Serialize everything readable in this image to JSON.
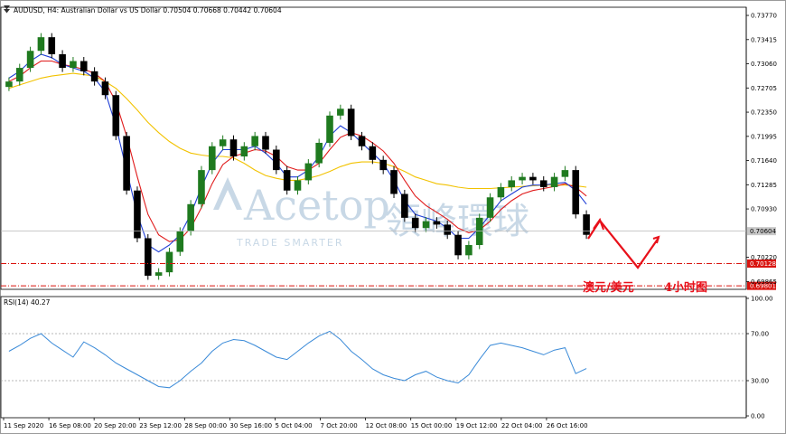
{
  "window": {
    "symbol_caption": "AUDUSD, H4:  Australian Dollar vs US Dollar  0.70504 0.70668 0.70442 0.70604"
  },
  "rsi": {
    "caption": "RSI(14) 40.27",
    "levels": [
      "100.00",
      "70.00",
      "30.00",
      "0.00"
    ]
  },
  "watermark": {
    "brand": "Acetop",
    "cn": "領峰環球",
    "tagline": "TRADE SMARTER"
  },
  "annotation": {
    "pair_cn": "澳元/美元",
    "timeframe_cn": "4小时图"
  },
  "colors": {
    "bull": "#1f7a1f",
    "bear": "#000000",
    "ma_blue": "#1f3fd6",
    "ma_red": "#e01b1b",
    "ma_yellow": "#f2c200",
    "rsi": "#3a8ad8",
    "level_red": "#d9140f",
    "arrow": "#e8101a"
  },
  "chart_data": [
    {
      "type": "candlestick",
      "title": "AUDUSD, H4:  Australian Dollar vs US Dollar",
      "ohlc_last": {
        "open": 0.70504,
        "high": 0.70668,
        "low": 0.70442,
        "close": 0.70604
      },
      "y_ticks": [
        "0.73770",
        "0.73415",
        "0.73060",
        "0.72705",
        "0.72350",
        "0.71995",
        "0.71640",
        "0.71285",
        "0.70930",
        "0.70220",
        "0.69865"
      ],
      "ylim": [
        0.6975,
        0.7389
      ],
      "x_ticks": [
        "11 Sep 2020",
        "16 Sep 08:00",
        "20 Sep 20:00",
        "23 Sep 12:00",
        "28 Sep 00:00",
        "30 Sep 16:00",
        "5 Oct 04:00",
        "7 Oct 20:00",
        "12 Oct 08:00",
        "15 Oct 00:00",
        "19 Oct 12:00",
        "22 Oct 04:00",
        "26 Oct 16:00"
      ],
      "current_price": "0.70604",
      "levels": [
        {
          "label": "0.70128",
          "value": 0.70128
        },
        {
          "label": "0.69801",
          "value": 0.69801
        }
      ],
      "series": [
        {
          "name": "close",
          "values": [
            0.728,
            0.73,
            0.7325,
            0.7345,
            0.732,
            0.73,
            0.731,
            0.7295,
            0.728,
            0.726,
            0.72,
            0.712,
            0.705,
            0.6995,
            0.7,
            0.703,
            0.706,
            0.71,
            0.715,
            0.7185,
            0.7195,
            0.717,
            0.7185,
            0.72,
            0.718,
            0.715,
            0.712,
            0.7135,
            0.716,
            0.719,
            0.723,
            0.724,
            0.72,
            0.7185,
            0.7165,
            0.715,
            0.7115,
            0.708,
            0.7065,
            0.7075,
            0.707,
            0.7055,
            0.7025,
            0.704,
            0.708,
            0.711,
            0.7125,
            0.7135,
            0.714,
            0.7135,
            0.7125,
            0.714,
            0.715,
            0.7085,
            0.7055
          ]
        },
        {
          "name": "ma_blue",
          "values": [
            0.7285,
            0.7295,
            0.731,
            0.732,
            0.7315,
            0.7305,
            0.73,
            0.7295,
            0.7285,
            0.7265,
            0.7215,
            0.715,
            0.7085,
            0.704,
            0.703,
            0.704,
            0.7055,
            0.7085,
            0.7125,
            0.716,
            0.718,
            0.718,
            0.718,
            0.7185,
            0.7175,
            0.716,
            0.714,
            0.714,
            0.715,
            0.717,
            0.72,
            0.7215,
            0.7205,
            0.719,
            0.7175,
            0.716,
            0.7135,
            0.7105,
            0.7085,
            0.708,
            0.7075,
            0.7065,
            0.705,
            0.705,
            0.7065,
            0.7085,
            0.7105,
            0.7115,
            0.7125,
            0.7128,
            0.7128,
            0.713,
            0.7132,
            0.712,
            0.71
          ]
        },
        {
          "name": "ma_red",
          "values": [
            0.728,
            0.7288,
            0.73,
            0.731,
            0.731,
            0.7305,
            0.7302,
            0.7298,
            0.7292,
            0.728,
            0.725,
            0.72,
            0.714,
            0.7085,
            0.7055,
            0.7045,
            0.7048,
            0.7065,
            0.7095,
            0.713,
            0.7158,
            0.717,
            0.7175,
            0.718,
            0.7178,
            0.717,
            0.7155,
            0.715,
            0.715,
            0.716,
            0.718,
            0.7198,
            0.7205,
            0.72,
            0.719,
            0.7178,
            0.716,
            0.7135,
            0.7112,
            0.7098,
            0.7088,
            0.7078,
            0.7065,
            0.7058,
            0.7062,
            0.7075,
            0.7092,
            0.7105,
            0.7115,
            0.712,
            0.7123,
            0.7126,
            0.713,
            0.7125,
            0.7112
          ]
        },
        {
          "name": "ma_yellow",
          "values": [
            0.727,
            0.7275,
            0.728,
            0.7285,
            0.7288,
            0.729,
            0.7292,
            0.729,
            0.7288,
            0.728,
            0.727,
            0.7255,
            0.7238,
            0.722,
            0.7205,
            0.7192,
            0.7182,
            0.7175,
            0.7172,
            0.717,
            0.717,
            0.7168,
            0.716,
            0.715,
            0.7142,
            0.7138,
            0.7135,
            0.7135,
            0.7138,
            0.7142,
            0.7148,
            0.7155,
            0.716,
            0.7162,
            0.7162,
            0.716,
            0.7155,
            0.7148,
            0.714,
            0.7135,
            0.713,
            0.7128,
            0.7125,
            0.7123,
            0.7123,
            0.7123,
            0.7124,
            0.7125,
            0.7126,
            0.7127,
            0.7128,
            0.7128,
            0.7128,
            0.7127,
            0.7125
          ]
        }
      ]
    },
    {
      "type": "line",
      "title": "RSI(14) 40.27",
      "ylim": [
        0,
        100
      ],
      "y_ticks": [
        "100.00",
        "70.00",
        "30.00",
        "0.00"
      ],
      "series": [
        {
          "name": "RSI(14)",
          "values": [
            55,
            60,
            66,
            70,
            62,
            56,
            50,
            63,
            58,
            52,
            45,
            40,
            35,
            30,
            25,
            24,
            30,
            38,
            45,
            55,
            62,
            65,
            64,
            60,
            55,
            50,
            48,
            55,
            62,
            68,
            72,
            65,
            55,
            48,
            40,
            35,
            32,
            30,
            35,
            38,
            33,
            30,
            28,
            35,
            48,
            60,
            62,
            60,
            58,
            55,
            52,
            56,
            58,
            36,
            40.27
          ]
        }
      ]
    }
  ]
}
